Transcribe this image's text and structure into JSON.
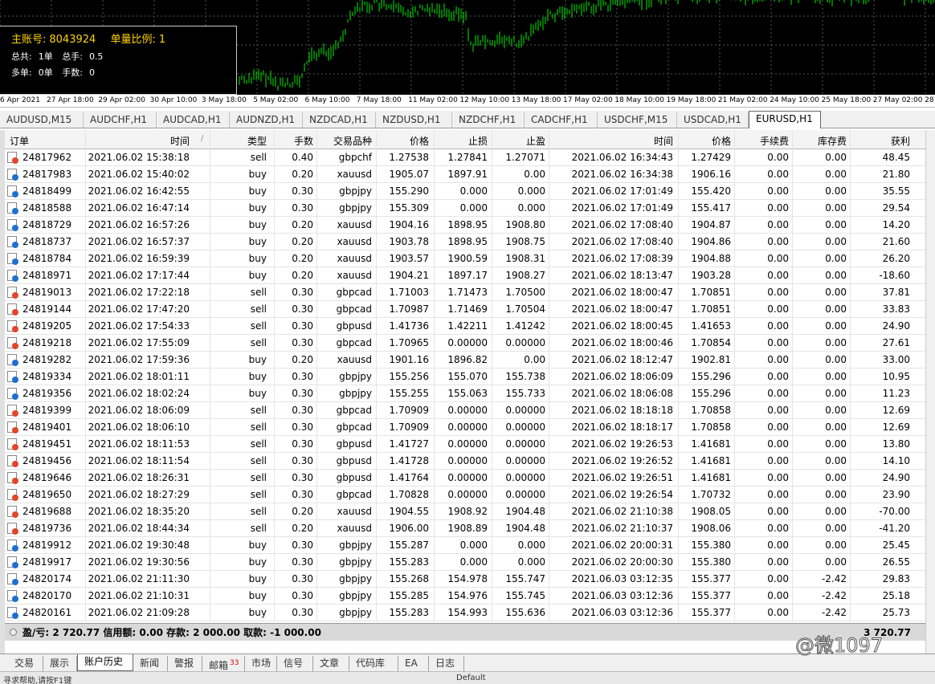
{
  "account_panel": {
    "account_label": "主账号:",
    "account_number": "8043924",
    "ratio_label": "单量比例:",
    "ratio_value": "1",
    "total_label": "总共:",
    "total_value": "1单",
    "total_lots_label": "总手:",
    "total_lots_value": "0.5",
    "long_label": "多单:",
    "long_value": "0单",
    "lots_label": "手数:",
    "lots_value": "0"
  },
  "time_axis": [
    "6 Apr 2021",
    "27 Apr 18:00",
    "29 Apr 02:00",
    "30 Apr 10:00",
    "3 May 18:00",
    "5 May 02:00",
    "6 May 10:00",
    "7 May 18:00",
    "11 May 02:00",
    "12 May 10:00",
    "13 May 18:00",
    "17 May 02:00",
    "18 May 10:00",
    "19 May 18:00",
    "21 May 02:00",
    "24 May 10:00",
    "25 May 18:00",
    "27 May 02:00",
    "28 M"
  ],
  "symbol_tabs": [
    "AUDUSD,M15",
    "AUDCHF,H1",
    "AUDCAD,H1",
    "AUDNZD,H1",
    "NZDCAD,H1",
    "NZDUSD,H1",
    "NZDCHF,H1",
    "CADCHF,H1",
    "USDCHF,M15",
    "USDCAD,H1",
    "EURUSD,H1"
  ],
  "active_symbol_tab": "EURUSD,H1",
  "columns": [
    "订单",
    "时间",
    "类型",
    "手数",
    "交易品种",
    "价格",
    "止损",
    "止盈",
    "时间",
    "价格",
    "手续费",
    "库存费",
    "获利"
  ],
  "sort_indicator": "/",
  "rows": [
    [
      "24817962",
      "2021.06.02 15:38:18",
      "sell",
      "0.40",
      "gbpchf",
      "1.27538",
      "1.27841",
      "1.27071",
      "2021.06.02 16:34:43",
      "1.27429",
      "0.00",
      "0.00",
      "48.45"
    ],
    [
      "24817983",
      "2021.06.02 15:40:02",
      "buy",
      "0.20",
      "xauusd",
      "1905.07",
      "1897.91",
      "0.00",
      "2021.06.02 16:34:38",
      "1906.16",
      "0.00",
      "0.00",
      "21.80"
    ],
    [
      "24818499",
      "2021.06.02 16:42:55",
      "buy",
      "0.30",
      "gbpjpy",
      "155.290",
      "0.000",
      "0.000",
      "2021.06.02 17:01:49",
      "155.420",
      "0.00",
      "0.00",
      "35.55"
    ],
    [
      "24818588",
      "2021.06.02 16:47:14",
      "buy",
      "0.30",
      "gbpjpy",
      "155.309",
      "0.000",
      "0.000",
      "2021.06.02 17:01:49",
      "155.417",
      "0.00",
      "0.00",
      "29.54"
    ],
    [
      "24818729",
      "2021.06.02 16:57:26",
      "buy",
      "0.20",
      "xauusd",
      "1904.16",
      "1898.95",
      "1908.80",
      "2021.06.02 17:08:40",
      "1904.87",
      "0.00",
      "0.00",
      "14.20"
    ],
    [
      "24818737",
      "2021.06.02 16:57:37",
      "buy",
      "0.20",
      "xauusd",
      "1903.78",
      "1898.95",
      "1908.75",
      "2021.06.02 17:08:40",
      "1904.86",
      "0.00",
      "0.00",
      "21.60"
    ],
    [
      "24818784",
      "2021.06.02 16:59:39",
      "buy",
      "0.20",
      "xauusd",
      "1903.57",
      "1900.59",
      "1908.31",
      "2021.06.02 17:08:39",
      "1904.88",
      "0.00",
      "0.00",
      "26.20"
    ],
    [
      "24818971",
      "2021.06.02 17:17:44",
      "buy",
      "0.20",
      "xauusd",
      "1904.21",
      "1897.17",
      "1908.27",
      "2021.06.02 18:13:47",
      "1903.28",
      "0.00",
      "0.00",
      "-18.60"
    ],
    [
      "24819013",
      "2021.06.02 17:22:18",
      "sell",
      "0.30",
      "gbpcad",
      "1.71003",
      "1.71473",
      "1.70500",
      "2021.06.02 18:00:47",
      "1.70851",
      "0.00",
      "0.00",
      "37.81"
    ],
    [
      "24819144",
      "2021.06.02 17:47:20",
      "sell",
      "0.30",
      "gbpcad",
      "1.70987",
      "1.71469",
      "1.70504",
      "2021.06.02 18:00:47",
      "1.70851",
      "0.00",
      "0.00",
      "33.83"
    ],
    [
      "24819205",
      "2021.06.02 17:54:33",
      "sell",
      "0.30",
      "gbpusd",
      "1.41736",
      "1.42211",
      "1.41242",
      "2021.06.02 18:00:45",
      "1.41653",
      "0.00",
      "0.00",
      "24.90"
    ],
    [
      "24819218",
      "2021.06.02 17:55:09",
      "sell",
      "0.30",
      "gbpcad",
      "1.70965",
      "0.00000",
      "0.00000",
      "2021.06.02 18:00:46",
      "1.70854",
      "0.00",
      "0.00",
      "27.61"
    ],
    [
      "24819282",
      "2021.06.02 17:59:36",
      "buy",
      "0.20",
      "xauusd",
      "1901.16",
      "1896.82",
      "0.00",
      "2021.06.02 18:12:47",
      "1902.81",
      "0.00",
      "0.00",
      "33.00"
    ],
    [
      "24819334",
      "2021.06.02 18:01:11",
      "buy",
      "0.30",
      "gbpjpy",
      "155.256",
      "155.070",
      "155.738",
      "2021.06.02 18:06:09",
      "155.296",
      "0.00",
      "0.00",
      "10.95"
    ],
    [
      "24819356",
      "2021.06.02 18:02:24",
      "buy",
      "0.30",
      "gbpjpy",
      "155.255",
      "155.063",
      "155.733",
      "2021.06.02 18:06:08",
      "155.296",
      "0.00",
      "0.00",
      "11.23"
    ],
    [
      "24819399",
      "2021.06.02 18:06:09",
      "sell",
      "0.30",
      "gbpcad",
      "1.70909",
      "0.00000",
      "0.00000",
      "2021.06.02 18:18:18",
      "1.70858",
      "0.00",
      "0.00",
      "12.69"
    ],
    [
      "24819401",
      "2021.06.02 18:06:10",
      "sell",
      "0.30",
      "gbpcad",
      "1.70909",
      "0.00000",
      "0.00000",
      "2021.06.02 18:18:17",
      "1.70858",
      "0.00",
      "0.00",
      "12.69"
    ],
    [
      "24819451",
      "2021.06.02 18:11:53",
      "sell",
      "0.30",
      "gbpusd",
      "1.41727",
      "0.00000",
      "0.00000",
      "2021.06.02 19:26:53",
      "1.41681",
      "0.00",
      "0.00",
      "13.80"
    ],
    [
      "24819456",
      "2021.06.02 18:11:54",
      "sell",
      "0.30",
      "gbpusd",
      "1.41728",
      "0.00000",
      "0.00000",
      "2021.06.02 19:26:52",
      "1.41681",
      "0.00",
      "0.00",
      "14.10"
    ],
    [
      "24819646",
      "2021.06.02 18:26:31",
      "sell",
      "0.30",
      "gbpusd",
      "1.41764",
      "0.00000",
      "0.00000",
      "2021.06.02 19:26:51",
      "1.41681",
      "0.00",
      "0.00",
      "24.90"
    ],
    [
      "24819650",
      "2021.06.02 18:27:29",
      "sell",
      "0.30",
      "gbpcad",
      "1.70828",
      "0.00000",
      "0.00000",
      "2021.06.02 19:26:54",
      "1.70732",
      "0.00",
      "0.00",
      "23.90"
    ],
    [
      "24819688",
      "2021.06.02 18:35:20",
      "sell",
      "0.20",
      "xauusd",
      "1904.55",
      "1908.92",
      "1904.48",
      "2021.06.02 21:10:38",
      "1908.05",
      "0.00",
      "0.00",
      "-70.00"
    ],
    [
      "24819736",
      "2021.06.02 18:44:34",
      "sell",
      "0.20",
      "xauusd",
      "1906.00",
      "1908.89",
      "1904.48",
      "2021.06.02 21:10:37",
      "1908.06",
      "0.00",
      "0.00",
      "-41.20"
    ],
    [
      "24819912",
      "2021.06.02 19:30:48",
      "buy",
      "0.30",
      "gbpjpy",
      "155.287",
      "0.000",
      "0.000",
      "2021.06.02 20:00:31",
      "155.380",
      "0.00",
      "0.00",
      "25.45"
    ],
    [
      "24819917",
      "2021.06.02 19:30:56",
      "buy",
      "0.30",
      "gbpjpy",
      "155.283",
      "0.000",
      "0.000",
      "2021.06.02 20:00:30",
      "155.380",
      "0.00",
      "0.00",
      "26.55"
    ],
    [
      "24820174",
      "2021.06.02 21:11:30",
      "buy",
      "0.30",
      "gbpjpy",
      "155.268",
      "154.978",
      "155.747",
      "2021.06.03 03:12:35",
      "155.377",
      "0.00",
      "-2.42",
      "29.83"
    ],
    [
      "24820170",
      "2021.06.02 21:10:31",
      "buy",
      "0.30",
      "gbpjpy",
      "155.285",
      "154.976",
      "155.745",
      "2021.06.03 03:12:36",
      "155.377",
      "0.00",
      "-2.42",
      "25.18"
    ],
    [
      "24820161",
      "2021.06.02 21:09:28",
      "buy",
      "0.30",
      "gbpjpy",
      "155.283",
      "154.993",
      "155.636",
      "2021.06.03 03:12:36",
      "155.377",
      "0.00",
      "-2.42",
      "25.73"
    ]
  ],
  "summary": {
    "text": "盈/亏: 2 720.77  信用额: 0.00  存款: 2 000.00  取款: -1 000.00",
    "total": "3 720.77"
  },
  "bottom_tabs": [
    "交易",
    "展示",
    "账户历史",
    "新闻",
    "警报",
    "邮箱",
    "市场",
    "信号",
    "文章",
    "代码库",
    "EA",
    "日志"
  ],
  "active_bottom_tab": "账户历史",
  "mail_count": "33",
  "status_left": "寻求帮助,请按F1键",
  "status_mid": "Default",
  "watermark": "@微1097",
  "colors": {
    "candle": "#00c800",
    "buy_dot": "#1f6fd1",
    "sell_dot": "#e2452a",
    "panel_text": "#ffd400"
  }
}
